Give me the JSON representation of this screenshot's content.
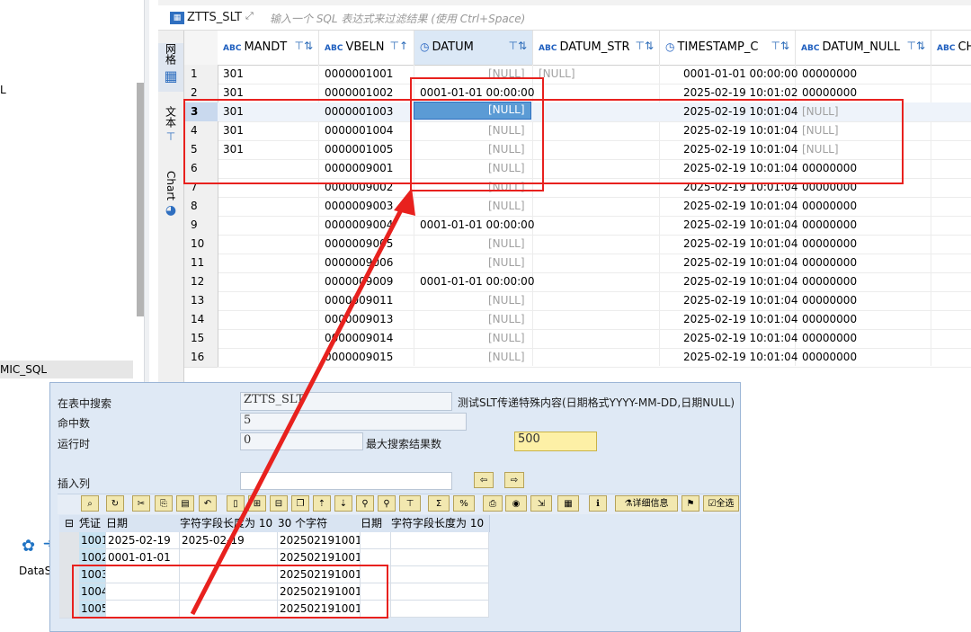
{
  "navigator": {
    "item_l": "L",
    "item_mic_sql": "MIC_SQL",
    "datas_label": "DataS"
  },
  "vertical_tabs": {
    "grid": "网格",
    "text": "文本",
    "chart": "Chart"
  },
  "filter_bar": {
    "table_name": "ZTTS_SLT",
    "placeholder": "输入一个 SQL 表达式来过滤结果 (使用 Ctrl+Space)"
  },
  "grid": {
    "columns": [
      {
        "label": "MANDT",
        "type_icon": "ABC"
      },
      {
        "label": "VBELN",
        "type_icon": "ABC"
      },
      {
        "label": "DATUM",
        "type_icon": "clock"
      },
      {
        "label": "DATUM_STR",
        "type_icon": "ABC"
      },
      {
        "label": "TIMESTAMP_C",
        "type_icon": "clock"
      },
      {
        "label": "DATUM_NULL",
        "type_icon": "ABC"
      },
      {
        "label": "CH",
        "type_icon": "ABC"
      }
    ],
    "rows": [
      {
        "n": "1",
        "mandt": "301",
        "vbeln": "0000001001",
        "datum": "[NULL]",
        "datum_str": "[NULL]",
        "ts": "0001-01-01 00:00:00",
        "dn": "00000000"
      },
      {
        "n": "2",
        "mandt": "301",
        "vbeln": "0000001002",
        "datum": "0001-01-01 00:00:00",
        "datum_str": "",
        "ts": "2025-02-19 10:01:02",
        "dn": "00000000"
      },
      {
        "n": "3",
        "mandt": "301",
        "vbeln": "0000001003",
        "datum": "[NULL]",
        "datum_str": "",
        "ts": "2025-02-19 10:01:04",
        "dn": "[NULL]"
      },
      {
        "n": "4",
        "mandt": "301",
        "vbeln": "0000001004",
        "datum": "[NULL]",
        "datum_str": "",
        "ts": "2025-02-19 10:01:04",
        "dn": "[NULL]"
      },
      {
        "n": "5",
        "mandt": "301",
        "vbeln": "0000001005",
        "datum": "[NULL]",
        "datum_str": "",
        "ts": "2025-02-19 10:01:04",
        "dn": "[NULL]"
      },
      {
        "n": "6",
        "mandt": "",
        "vbeln": "0000009001",
        "datum": "[NULL]",
        "datum_str": "",
        "ts": "2025-02-19 10:01:04",
        "dn": "00000000"
      },
      {
        "n": "7",
        "mandt": "",
        "vbeln": "0000009002",
        "datum": "[NULL]",
        "datum_str": "",
        "ts": "2025-02-19 10:01:04",
        "dn": "00000000"
      },
      {
        "n": "8",
        "mandt": "",
        "vbeln": "0000009003",
        "datum": "[NULL]",
        "datum_str": "",
        "ts": "2025-02-19 10:01:04",
        "dn": "00000000"
      },
      {
        "n": "9",
        "mandt": "",
        "vbeln": "0000009004",
        "datum": "0001-01-01 00:00:00",
        "datum_str": "",
        "ts": "2025-02-19 10:01:04",
        "dn": "00000000"
      },
      {
        "n": "10",
        "mandt": "",
        "vbeln": "0000009005",
        "datum": "[NULL]",
        "datum_str": "",
        "ts": "2025-02-19 10:01:04",
        "dn": "00000000"
      },
      {
        "n": "11",
        "mandt": "",
        "vbeln": "0000009006",
        "datum": "[NULL]",
        "datum_str": "",
        "ts": "2025-02-19 10:01:04",
        "dn": "00000000"
      },
      {
        "n": "12",
        "mandt": "",
        "vbeln": "0000009009",
        "datum": "0001-01-01 00:00:00",
        "datum_str": "",
        "ts": "2025-02-19 10:01:04",
        "dn": "00000000"
      },
      {
        "n": "13",
        "mandt": "",
        "vbeln": "0000009011",
        "datum": "[NULL]",
        "datum_str": "",
        "ts": "2025-02-19 10:01:04",
        "dn": "00000000"
      },
      {
        "n": "14",
        "mandt": "",
        "vbeln": "0000009013",
        "datum": "[NULL]",
        "datum_str": "",
        "ts": "2025-02-19 10:01:04",
        "dn": "00000000"
      },
      {
        "n": "15",
        "mandt": "",
        "vbeln": "0000009014",
        "datum": "[NULL]",
        "datum_str": "",
        "ts": "2025-02-19 10:01:04",
        "dn": "00000000"
      },
      {
        "n": "16",
        "mandt": "",
        "vbeln": "0000009015",
        "datum": "[NULL]",
        "datum_str": "",
        "ts": "2025-02-19 10:01:04",
        "dn": "00000000"
      }
    ]
  },
  "sap": {
    "label_search_table": "在表中搜索",
    "table_value": "ZTTS_SLT",
    "table_desc": "测试SLT传递特殊内容(日期格式YYYY-MM-DD,日期NULL)",
    "label_hits": "命中数",
    "hits_value": "5",
    "label_runtime": "运行时",
    "runtime_value": "0",
    "label_max_results": "最大搜索结果数",
    "max_results_value": "500",
    "label_insert_col": "插入列",
    "btn_details": "详细信息",
    "btn_all": "全选",
    "table_headers": [
      "凭证",
      "日期",
      "字符字段长度为 10",
      "30 个字符",
      "日期",
      "字符字段长度为 10"
    ],
    "table_rows": [
      [
        "1001",
        "2025-02-19",
        "2025-02-19",
        "20250219100101",
        "",
        ""
      ],
      [
        "1002",
        "0001-01-01",
        "",
        "20250219100102",
        "",
        ""
      ],
      [
        "1003",
        "",
        "",
        "20250219100104",
        "",
        ""
      ],
      [
        "1004",
        "",
        "",
        "20250219100104",
        "",
        ""
      ],
      [
        "1005",
        "",
        "",
        "20250219100104",
        "",
        ""
      ]
    ]
  },
  "colors": {
    "highlight": "#e8211e",
    "selected_cell": "#5b9bd5",
    "sap_bg": "#dfe9f5"
  }
}
